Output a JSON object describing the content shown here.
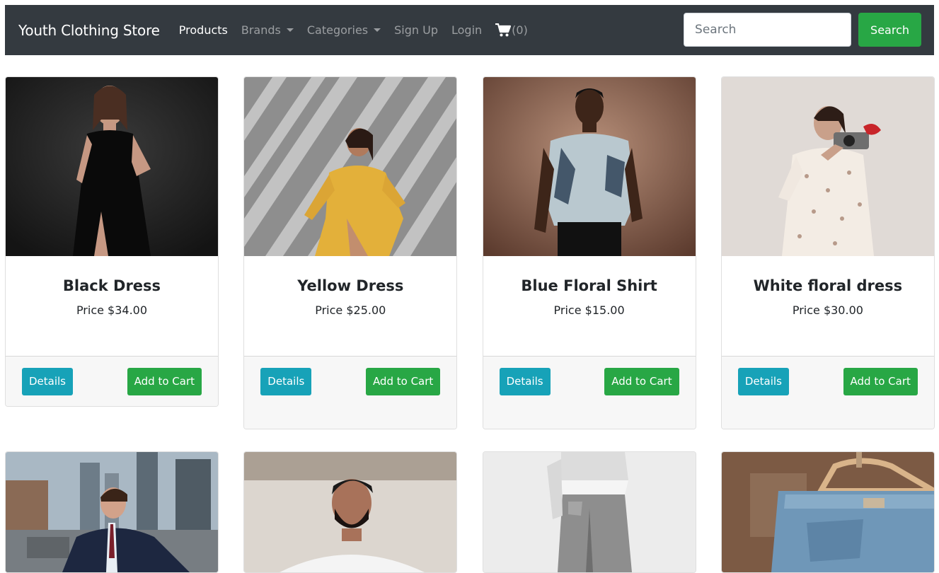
{
  "navbar": {
    "brand": "Youth Clothing Store",
    "links": [
      {
        "label": "Products",
        "active": true
      },
      {
        "label": "Brands",
        "dropdown": true
      },
      {
        "label": "Categories",
        "dropdown": true
      },
      {
        "label": "Sign Up"
      },
      {
        "label": "Login"
      }
    ],
    "cart_count": "(0)",
    "search_placeholder": "Search",
    "search_button": "Search"
  },
  "products": [
    {
      "name": "Black Dress",
      "price": "Price $34.00",
      "details": "Details",
      "add": "Add to Cart"
    },
    {
      "name": "Yellow Dress",
      "price": "Price $25.00",
      "details": "Details",
      "add": "Add to Cart"
    },
    {
      "name": "Blue Floral Shirt",
      "price": "Price $15.00",
      "details": "Details",
      "add": "Add to Cart"
    },
    {
      "name": "White floral dress",
      "price": "Price $30.00",
      "details": "Details",
      "add": "Add to Cart"
    }
  ],
  "colors": {
    "navbar_bg": "#343a40",
    "success": "#28a745",
    "info": "#17a2b8",
    "footer_bg": "#f7f7f7"
  }
}
